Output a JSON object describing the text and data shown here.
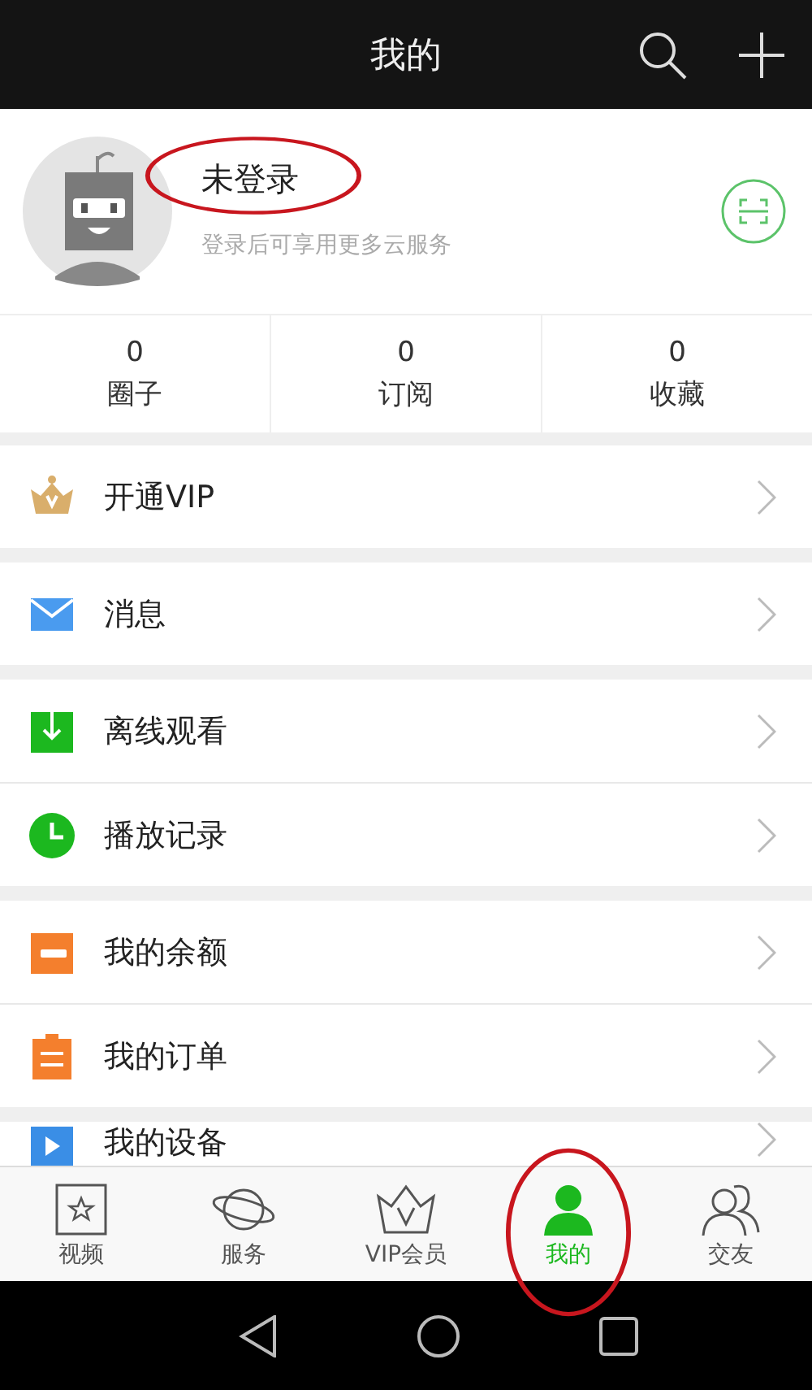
{
  "header": {
    "title": "我的"
  },
  "profile": {
    "name": "未登录",
    "subtitle": "登录后可享用更多云服务",
    "name_highlighted": true
  },
  "stats": [
    {
      "value": "0",
      "label": "圈子"
    },
    {
      "value": "0",
      "label": "订阅"
    },
    {
      "value": "0",
      "label": "收藏"
    }
  ],
  "menu_groups": [
    [
      {
        "kind": "vip",
        "label": "开通VIP"
      }
    ],
    [
      {
        "kind": "mail",
        "label": "消息"
      }
    ],
    [
      {
        "kind": "download",
        "label": "离线观看"
      },
      {
        "kind": "clock",
        "label": "播放记录"
      }
    ],
    [
      {
        "kind": "wallet",
        "label": "我的余额"
      },
      {
        "kind": "order",
        "label": "我的订单"
      }
    ],
    [
      {
        "kind": "device",
        "label": "我的设备"
      }
    ]
  ],
  "tabs": [
    {
      "kind": "video",
      "label": "视频",
      "selected": false,
      "highlighted": false
    },
    {
      "kind": "planet",
      "label": "服务",
      "selected": false,
      "highlighted": false
    },
    {
      "kind": "crown",
      "label": "VIP会员",
      "selected": false,
      "highlighted": false
    },
    {
      "kind": "person",
      "label": "我的",
      "selected": true,
      "highlighted": true
    },
    {
      "kind": "people",
      "label": "交友",
      "selected": false,
      "highlighted": false
    }
  ]
}
